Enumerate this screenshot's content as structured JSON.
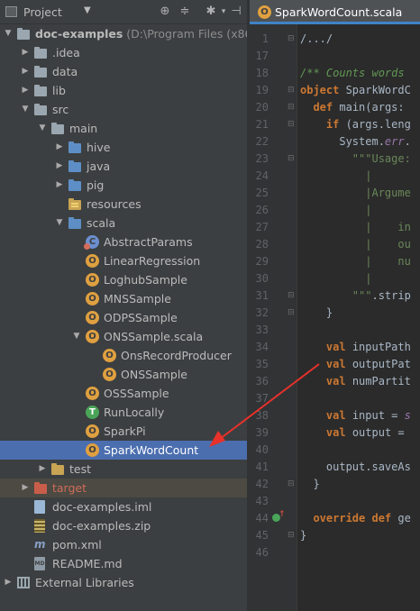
{
  "project_panel": {
    "title": "Project",
    "tree": [
      {
        "label": "doc-examples",
        "path": " (D:\\Program Files (x86)\\At",
        "indent": 0,
        "arrow": "down",
        "icon": "folder-gray",
        "icon_name": "module-folder-icon"
      },
      {
        "label": ".idea",
        "indent": 1,
        "arrow": "right",
        "icon": "folder-gray",
        "icon_name": "folder-icon"
      },
      {
        "label": "data",
        "indent": 1,
        "arrow": "right",
        "icon": "folder-gray",
        "icon_name": "folder-icon"
      },
      {
        "label": "lib",
        "indent": 1,
        "arrow": "right",
        "icon": "folder-gray",
        "icon_name": "folder-icon"
      },
      {
        "label": "src",
        "indent": 1,
        "arrow": "down",
        "icon": "folder-gray",
        "icon_name": "folder-icon"
      },
      {
        "label": "main",
        "indent": 2,
        "arrow": "down",
        "icon": "folder-gray",
        "icon_name": "folder-icon"
      },
      {
        "label": "hive",
        "indent": 3,
        "arrow": "right",
        "icon": "folder-blue",
        "icon_name": "source-folder-icon"
      },
      {
        "label": "java",
        "indent": 3,
        "arrow": "right",
        "icon": "folder-blue",
        "icon_name": "source-folder-icon"
      },
      {
        "label": "pig",
        "indent": 3,
        "arrow": "right",
        "icon": "folder-blue",
        "icon_name": "source-folder-icon"
      },
      {
        "label": "resources",
        "indent": 3,
        "arrow": "none",
        "icon": "folder-res",
        "icon_name": "resources-folder-icon"
      },
      {
        "label": "scala",
        "indent": 3,
        "arrow": "down",
        "icon": "folder-blue",
        "icon_name": "source-folder-icon"
      },
      {
        "label": "AbstractParams",
        "indent": 4,
        "arrow": "none",
        "icon": "class",
        "icon_name": "abstract-class-icon"
      },
      {
        "label": "LinearRegression",
        "indent": 4,
        "arrow": "none",
        "icon": "object",
        "icon_name": "scala-object-icon"
      },
      {
        "label": "LoghubSample",
        "indent": 4,
        "arrow": "none",
        "icon": "object",
        "icon_name": "scala-object-icon"
      },
      {
        "label": "MNSSample",
        "indent": 4,
        "arrow": "none",
        "icon": "object",
        "icon_name": "scala-object-icon"
      },
      {
        "label": "ODPSSample",
        "indent": 4,
        "arrow": "none",
        "icon": "object",
        "icon_name": "scala-object-icon"
      },
      {
        "label": "ONSSample.scala",
        "indent": 4,
        "arrow": "down",
        "icon": "object",
        "icon_name": "scala-file-icon"
      },
      {
        "label": "OnsRecordProducer",
        "indent": 5,
        "arrow": "none",
        "icon": "object",
        "icon_name": "scala-object-icon"
      },
      {
        "label": "ONSSample",
        "indent": 5,
        "arrow": "none",
        "icon": "object",
        "icon_name": "scala-object-icon"
      },
      {
        "label": "OSSSample",
        "indent": 4,
        "arrow": "none",
        "icon": "object",
        "icon_name": "scala-object-icon"
      },
      {
        "label": "RunLocally",
        "indent": 4,
        "arrow": "none",
        "icon": "trait",
        "icon_name": "scala-trait-icon"
      },
      {
        "label": "SparkPi",
        "indent": 4,
        "arrow": "none",
        "icon": "object",
        "icon_name": "scala-object-icon"
      },
      {
        "label": "SparkWordCount",
        "indent": 4,
        "arrow": "none",
        "icon": "object",
        "icon_name": "scala-object-icon",
        "selected": true
      },
      {
        "label": "test",
        "indent": 2,
        "arrow": "right",
        "icon": "folder-orange",
        "icon_name": "test-folder-icon"
      },
      {
        "label": "target",
        "indent": 1,
        "arrow": "right",
        "icon": "folder-red",
        "icon_name": "excluded-folder-icon",
        "highlight": true
      },
      {
        "label": "doc-examples.iml",
        "indent": 1,
        "arrow": "none",
        "icon": "file-iml",
        "icon_name": "iml-file-icon"
      },
      {
        "label": "doc-examples.zip",
        "indent": 1,
        "arrow": "none",
        "icon": "file-zip",
        "icon_name": "zip-file-icon"
      },
      {
        "label": "pom.xml",
        "indent": 1,
        "arrow": "none",
        "icon": "maven",
        "icon_name": "maven-icon"
      },
      {
        "label": "README.md",
        "indent": 1,
        "arrow": "none",
        "icon": "file-md",
        "icon_name": "markdown-file-icon"
      },
      {
        "label": "External Libraries",
        "indent": 0,
        "arrow": "right",
        "icon": "lib",
        "icon_name": "library-icon"
      }
    ]
  },
  "editor": {
    "tab_label": "SparkWordCount.scala",
    "line_numbers": [
      "1",
      "17",
      "18",
      "19",
      "20",
      "21",
      "22",
      "23",
      "24",
      "25",
      "26",
      "27",
      "28",
      "29",
      "30",
      "31",
      "32",
      "33",
      "34",
      "35",
      "36",
      "37",
      "38",
      "39",
      "40",
      "41",
      "42",
      "43",
      "44",
      "45",
      "46"
    ],
    "lines": [
      [
        {
          "t": "/.../",
          "c": "pl"
        }
      ],
      [],
      [
        {
          "t": "/** Counts words",
          "c": "cm"
        }
      ],
      [
        {
          "t": "object",
          "c": "kw"
        },
        {
          "t": " SparkWordC",
          "c": "pl"
        }
      ],
      [
        {
          "t": "  ",
          "c": "pl"
        },
        {
          "t": "def",
          "c": "kw"
        },
        {
          "t": " main(args: ",
          "c": "pl"
        }
      ],
      [
        {
          "t": "    ",
          "c": "pl"
        },
        {
          "t": "if",
          "c": "kw"
        },
        {
          "t": " (args.leng",
          "c": "pl"
        }
      ],
      [
        {
          "t": "      System.",
          "c": "pl"
        },
        {
          "t": "err",
          "c": "it"
        },
        {
          "t": ".",
          "c": "pl"
        }
      ],
      [
        {
          "t": "        ",
          "c": "pl"
        },
        {
          "t": "\"\"\"Usage:",
          "c": "str"
        }
      ],
      [
        {
          "t": "          |",
          "c": "str"
        }
      ],
      [
        {
          "t": "          |Argume",
          "c": "str"
        }
      ],
      [
        {
          "t": "          |",
          "c": "str"
        }
      ],
      [
        {
          "t": "          |    in",
          "c": "str"
        }
      ],
      [
        {
          "t": "          |    ou",
          "c": "str"
        }
      ],
      [
        {
          "t": "          |    nu",
          "c": "str"
        }
      ],
      [
        {
          "t": "          |",
          "c": "str"
        }
      ],
      [
        {
          "t": "        \"\"\"",
          "c": "str"
        },
        {
          "t": ".strip",
          "c": "pl"
        }
      ],
      [
        {
          "t": "    }",
          "c": "pl"
        }
      ],
      [],
      [
        {
          "t": "    ",
          "c": "pl"
        },
        {
          "t": "val",
          "c": "kw"
        },
        {
          "t": " inputPath",
          "c": "pl"
        }
      ],
      [
        {
          "t": "    ",
          "c": "pl"
        },
        {
          "t": "val",
          "c": "kw"
        },
        {
          "t": " outputPat",
          "c": "pl"
        }
      ],
      [
        {
          "t": "    ",
          "c": "pl"
        },
        {
          "t": "val",
          "c": "kw"
        },
        {
          "t": " numPartit",
          "c": "pl"
        }
      ],
      [],
      [
        {
          "t": "    ",
          "c": "pl"
        },
        {
          "t": "val",
          "c": "kw"
        },
        {
          "t": " input = ",
          "c": "pl"
        },
        {
          "t": "s",
          "c": "it"
        }
      ],
      [
        {
          "t": "    ",
          "c": "pl"
        },
        {
          "t": "val",
          "c": "kw"
        },
        {
          "t": " output = ",
          "c": "pl"
        }
      ],
      [],
      [
        {
          "t": "    output.saveAs",
          "c": "pl"
        }
      ],
      [
        {
          "t": "  }",
          "c": "pl"
        }
      ],
      [],
      [
        {
          "t": "  ",
          "c": "pl"
        },
        {
          "t": "override def",
          "c": "kw"
        },
        {
          "t": " ge",
          "c": "pl"
        }
      ],
      [
        {
          "t": "}",
          "c": "pl"
        }
      ],
      []
    ]
  },
  "colors": {
    "selection": "#4b6eaf",
    "keyword": "#cc7832",
    "comment": "#629755",
    "string": "#6a8759",
    "annotation_arrow": "#e8312a"
  }
}
